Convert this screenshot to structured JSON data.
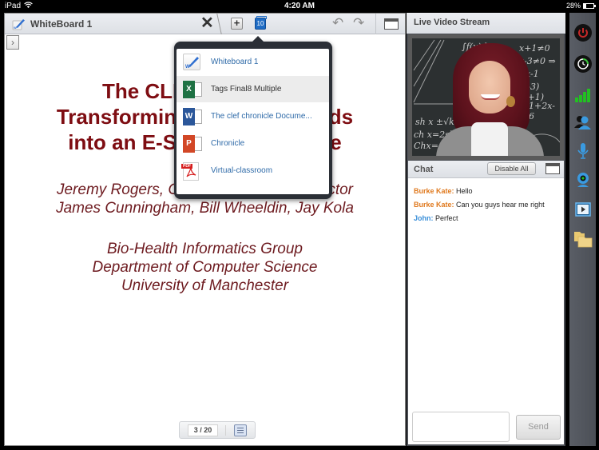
{
  "status_bar": {
    "device": "iPad",
    "time": "4:20 AM",
    "battery_percent_label": "28%",
    "battery_level": 0.28
  },
  "whiteboard": {
    "tab_title": "WhiteBoard 1",
    "close_glyph": "✕",
    "add_glyph": "+",
    "open_documents_count": "10",
    "undo_glyph": "↶",
    "redo_glyph": "↷",
    "side_toggle_glyph": "›",
    "icons": {
      "tab": "whiteboard-pen-icon",
      "close": "close-icon",
      "add": "plus-icon",
      "documents": "documents-stack-icon",
      "undo": "undo-icon",
      "redo": "redo-icon",
      "window": "window-maximize-icon",
      "side_toggle": "chevron-right-icon"
    }
  },
  "slide": {
    "title_lines": [
      "The CLEF Chronicle:",
      "Transforming Patient Records",
      "into an E-Science Resource"
    ],
    "author_lines": [
      "Jeremy Rogers, Colin Puleston, Alan Rector",
      "James Cunningham, Bill Wheeldin, Jay Kola"
    ],
    "affiliation_lines": [
      "Bio-Health Informatics Group",
      "Department of Computer Science",
      "University of Manchester"
    ],
    "text_color": "#7e0d12"
  },
  "pager": {
    "current_page": 3,
    "total_pages": 20,
    "label": "3 / 20",
    "list_icon": "page-list-icon"
  },
  "document_menu": {
    "items": [
      {
        "label": "Whiteboard 1",
        "type": "whiteboard",
        "icon": "whiteboard-file-icon",
        "selected": false
      },
      {
        "label": "Tags Final8 Multiple",
        "type": "excel",
        "icon": "excel-file-icon",
        "selected": true
      },
      {
        "label": "The clef chronicle Docume...",
        "type": "word",
        "icon": "word-file-icon",
        "selected": false
      },
      {
        "label": "Chronicle",
        "type": "powerpoint",
        "icon": "powerpoint-file-icon",
        "selected": false
      },
      {
        "label": "Virtual-classroom",
        "type": "pdf",
        "icon": "pdf-file-icon",
        "selected": false
      }
    ],
    "badges": {
      "excel": "X",
      "word": "W",
      "powerpoint": "P",
      "pdf": "PDF"
    }
  },
  "video": {
    "header": "Live Video Stream",
    "chalk_text": [
      "∫f(x)dx",
      "x+1≠0",
      "x-3≠0 ⇒",
      "x-1",
      "(x-3)(x+1)",
      "1+2x-6",
      "sh x ±√k",
      "ch x=2sh",
      "Chx=ch"
    ]
  },
  "chat": {
    "title": "Chat",
    "disable_all_label": "Disable All",
    "messages": [
      {
        "sender": "Burke Kate:",
        "text": " Hello",
        "sender_color": "#e07a1f"
      },
      {
        "sender": "Burke Kate:",
        "text": " Can you guys hear me right",
        "sender_color": "#e07a1f"
      },
      {
        "sender": "John:",
        "text": " Perfect",
        "sender_color": "#3a8fd9"
      }
    ],
    "input_value": "",
    "send_label": "Send"
  },
  "dock": {
    "items": [
      {
        "name": "power-icon",
        "color": "#c62828"
      },
      {
        "name": "clock-icon",
        "color": "#3cc43c"
      },
      {
        "name": "signal-strength-icon",
        "color": "#22c022"
      },
      {
        "name": "participants-icon",
        "color": "#3a9ae0"
      },
      {
        "name": "microphone-icon",
        "color": "#3a9ae0"
      },
      {
        "name": "webcam-icon",
        "color": "#3a9ae0"
      },
      {
        "name": "media-player-icon",
        "color": "#3a9ae0"
      },
      {
        "name": "folder-icon",
        "color": "#e8c870"
      }
    ]
  }
}
